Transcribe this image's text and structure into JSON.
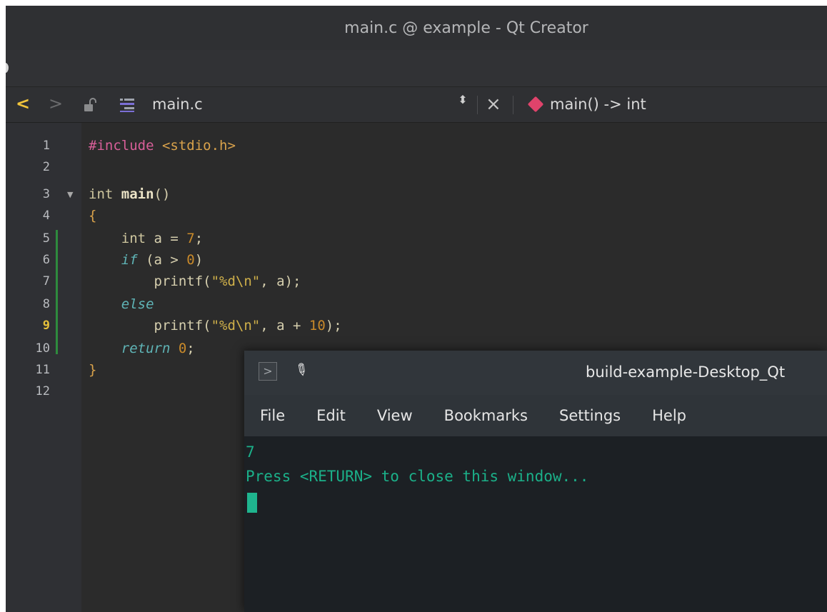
{
  "window": {
    "title": "main.c @ example - Qt Creator"
  },
  "editor_header": {
    "file_name": "main.c",
    "symbol": "main() -> int",
    "back_glyph": "<",
    "forward_glyph": ">",
    "updown_glyph": "⬍",
    "close_glyph": "×",
    "accent_color": "#f1c43b",
    "symbol_color": "#e0436b"
  },
  "editor": {
    "line_numbers": [
      "1",
      "2",
      "3",
      "4",
      "5",
      "6",
      "7",
      "8",
      "9",
      "10",
      "11",
      "12"
    ],
    "current_line": "9",
    "fold_marker": "▼",
    "code": {
      "l1_pre": "#include",
      "l1_inc": " <stdio.h>",
      "l3_type": "int ",
      "l3_func": "main",
      "l3_paren": "()",
      "l4": "{",
      "l5_type": "    int",
      "l5_rest": " a = ",
      "l5_num": "7",
      "l5_end": ";",
      "l6_kw": "    if",
      "l6_rest": " (a > ",
      "l6_num": "0",
      "l6_end": ")",
      "l7_a": "        printf(",
      "l7_str": "\"%d\\n\"",
      "l7_b": ", a);",
      "l8_kw": "    else",
      "l9_a": "        printf(",
      "l9_str": "\"%d\\n\"",
      "l9_b": ", a + ",
      "l9_num": "10",
      "l9_end": ");",
      "l10_kw": "    return",
      "l10_sp": " ",
      "l10_num": "0",
      "l10_end": ";",
      "l11": "}"
    }
  },
  "terminal": {
    "title": "build-example-Desktop_Qt",
    "prompt_glyph": ">",
    "pin_glyph": "📌",
    "menu": [
      "File",
      "Edit",
      "View",
      "Bookmarks",
      "Settings",
      "Help"
    ],
    "output": [
      "7",
      "Press <RETURN> to close this window..."
    ],
    "text_color": "#1bb089"
  }
}
